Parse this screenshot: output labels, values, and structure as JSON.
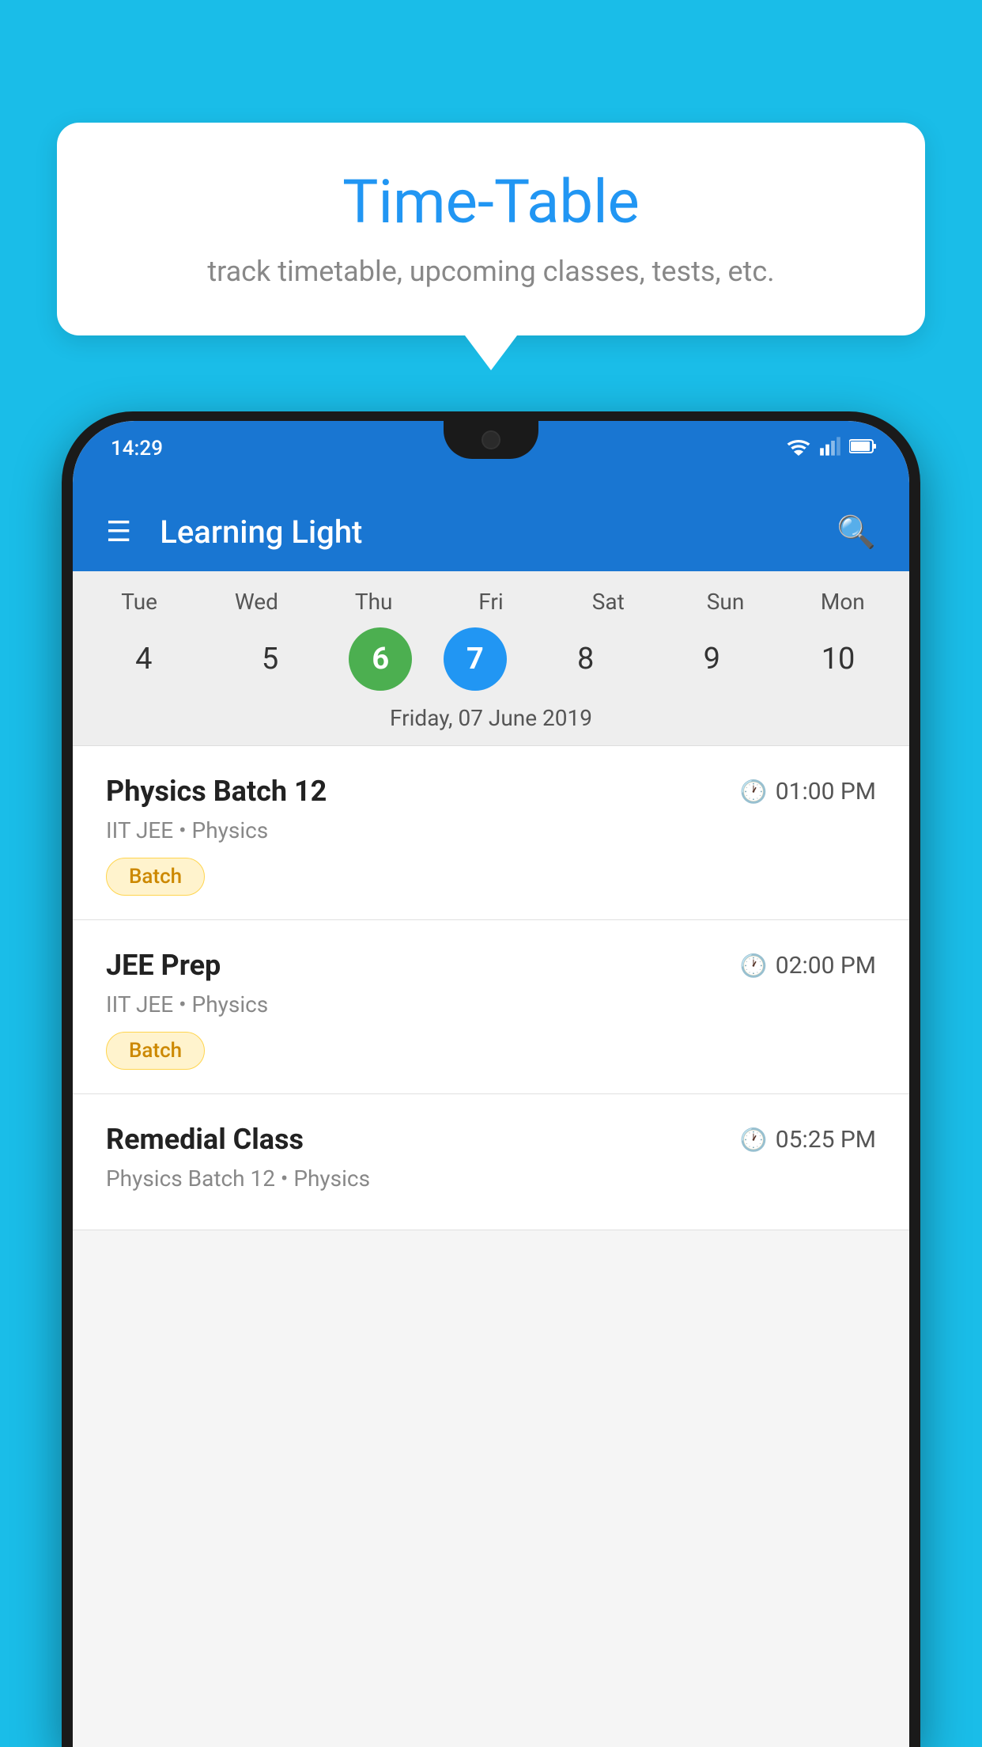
{
  "background_color": "#1ABDE8",
  "tooltip": {
    "title": "Time-Table",
    "subtitle": "track timetable, upcoming classes, tests, etc."
  },
  "phone": {
    "status_bar": {
      "time": "14:29"
    },
    "toolbar": {
      "app_name": "Learning Light",
      "menu_icon": "menu",
      "search_icon": "search"
    },
    "calendar": {
      "days": [
        {
          "label": "Tue",
          "number": "4",
          "state": "normal"
        },
        {
          "label": "Wed",
          "number": "5",
          "state": "normal"
        },
        {
          "label": "Thu",
          "number": "6",
          "state": "today"
        },
        {
          "label": "Fri",
          "number": "7",
          "state": "selected"
        },
        {
          "label": "Sat",
          "number": "8",
          "state": "normal"
        },
        {
          "label": "Sun",
          "number": "9",
          "state": "normal"
        },
        {
          "label": "Mon",
          "number": "10",
          "state": "normal"
        }
      ],
      "selected_date_label": "Friday, 07 June 2019"
    },
    "schedule_items": [
      {
        "id": 1,
        "title": "Physics Batch 12",
        "time": "01:00 PM",
        "subtitle": "IIT JEE • Physics",
        "badge": "Batch"
      },
      {
        "id": 2,
        "title": "JEE Prep",
        "time": "02:00 PM",
        "subtitle": "IIT JEE • Physics",
        "badge": "Batch"
      },
      {
        "id": 3,
        "title": "Remedial Class",
        "time": "05:25 PM",
        "subtitle": "Physics Batch 12 • Physics",
        "badge": null
      }
    ]
  }
}
